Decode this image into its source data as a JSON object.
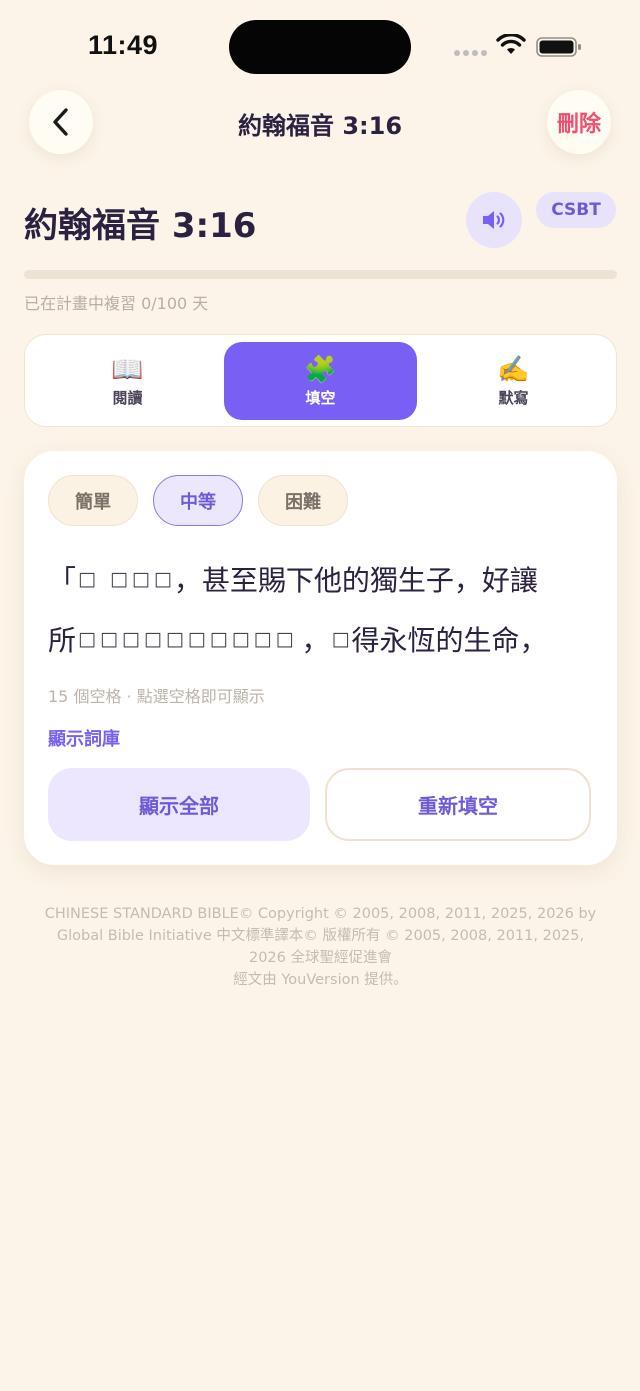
{
  "status_bar": {
    "time": "11:49"
  },
  "header": {
    "title": "約翰福音 3:16",
    "delete_label": "刪除"
  },
  "verse": {
    "reference": "約翰福音 3:16",
    "version": "CSBT",
    "progress_fraction": 0.0,
    "progress_text": "已在計畫中複習 0/100 天"
  },
  "modes": [
    {
      "icon": "📖",
      "label": "閱讀",
      "active": false
    },
    {
      "icon": "🧩",
      "label": "填空",
      "active": true
    },
    {
      "icon": "✍️",
      "label": "默寫",
      "active": false
    }
  ],
  "difficulty": {
    "easy": "簡單",
    "medium": "中等",
    "hard": "困難",
    "selected": "medium"
  },
  "cloze": {
    "line1_a": "「",
    "blank": "□",
    "line1_b": "，甚至賜下他的獨生子，好讓",
    "line2_a": "所",
    "line2_b": "，",
    "line2_c": "得永恆的生命，",
    "hint": "15 個空格 · 點選空格即可顯示",
    "show_bank": "顯示詞庫",
    "show_all": "顯示全部",
    "refill": "重新填空"
  },
  "copyright": {
    "line1": "CHINESE STANDARD BIBLE© Copyright © 2005, 2008, 2011, 2025, 2026 by",
    "line2": "Global Bible Initiative 中文標準譯本© 版權所有 © 2005, 2008, 2011, 2025,",
    "line3": "2026 全球聖經促進會",
    "line4": "經文由 YouVersion 提供。"
  },
  "colors": {
    "background": "#FCF4E8",
    "accent": "#7A5FF5",
    "delete": "#F0506E"
  }
}
